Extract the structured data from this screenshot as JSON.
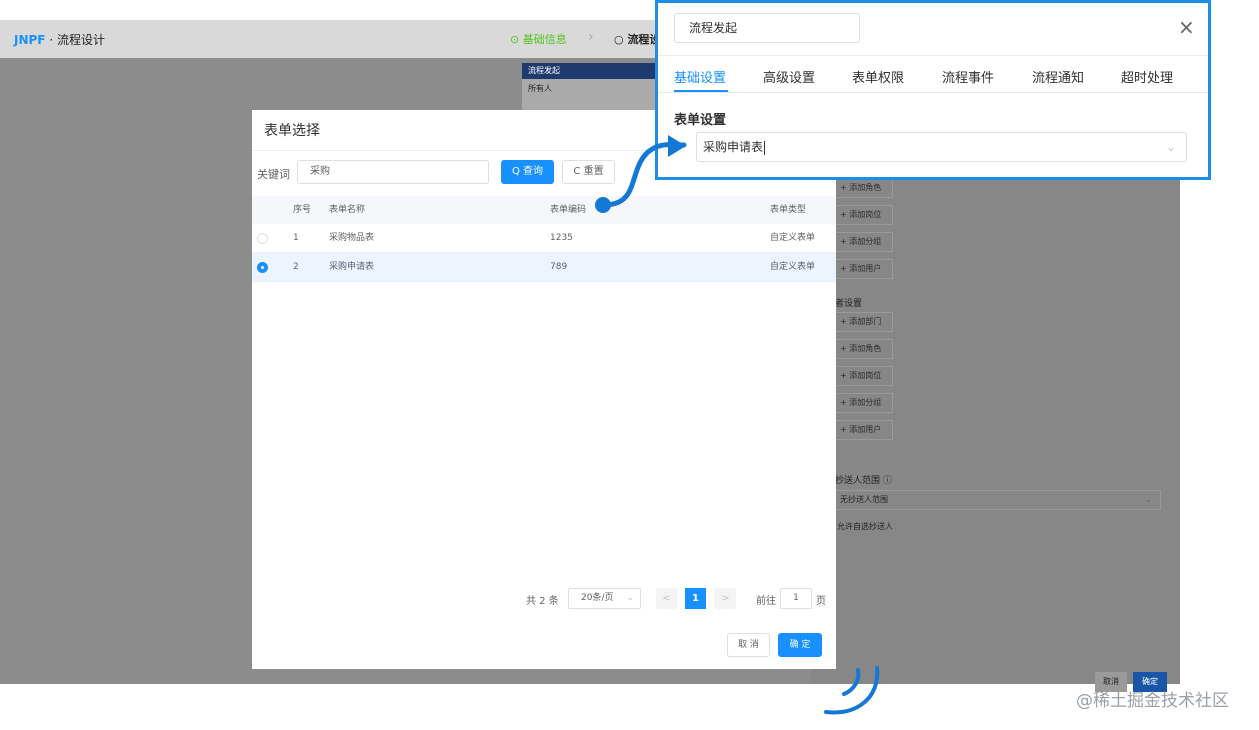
{
  "app": {
    "logo_brand": "JNPF",
    "logo_suffix": "· 流程设计",
    "steps": [
      "基础信息",
      "流程设"
    ],
    "canvas_node": {
      "title": "流程发起",
      "body": "所有人"
    }
  },
  "drawer": {
    "group1": [
      "+ 添加角色",
      "+ 添加岗位",
      "+ 添加分组",
      "+ 添加用户"
    ],
    "section2_title": "者设置",
    "group2": [
      "+ 添加部门",
      "+ 添加角色",
      "+ 添加岗位",
      "+ 添加分组",
      "+ 添加用户"
    ],
    "cc_label": "抄送人范围 ⓘ",
    "cc_select": "无抄送人范围",
    "allow_checkbox": "允许自选抄送人",
    "cancel": "取消",
    "confirm": "确定"
  },
  "modal": {
    "title": "表单选择",
    "keyword_label": "关键词",
    "keyword_value": "采购",
    "search_btn": "Q 查询",
    "reset_btn": "C 重置",
    "columns": [
      "序号",
      "表单名称",
      "表单编码",
      "表单类型"
    ],
    "rows": [
      {
        "idx": "1",
        "name": "采购物品表",
        "code": "1235",
        "type": "自定义表单"
      },
      {
        "idx": "2",
        "name": "采购申请表",
        "code": "789",
        "type": "自定义表单"
      }
    ],
    "pagination": {
      "total": "共 2 条",
      "page_size": "20条/页",
      "prev": "<",
      "current": "1",
      "next": ">",
      "goto_label": "前往",
      "goto_value": "1",
      "page_unit": "页"
    },
    "cancel": "取 消",
    "confirm": "确 定"
  },
  "callout": {
    "title_box": "流程发起",
    "close": "×",
    "tabs": [
      "基础设置",
      "高级设置",
      "表单权限",
      "流程事件",
      "流程通知",
      "超时处理"
    ],
    "active_tab": "基础设置",
    "section_title": "表单设置",
    "select_value": "采购申请表"
  },
  "watermark": "@稀土掘金技术社区",
  "colors": {
    "primary": "#1890ff",
    "callout_border": "#1c8ee8",
    "overlay": "#8c8c8c"
  },
  "icons": [
    "check-circle-icon",
    "circle-icon",
    "chevron-right-icon",
    "search-icon",
    "refresh-icon",
    "radio-icon",
    "chevron-down-icon",
    "close-icon",
    "info-icon"
  ]
}
